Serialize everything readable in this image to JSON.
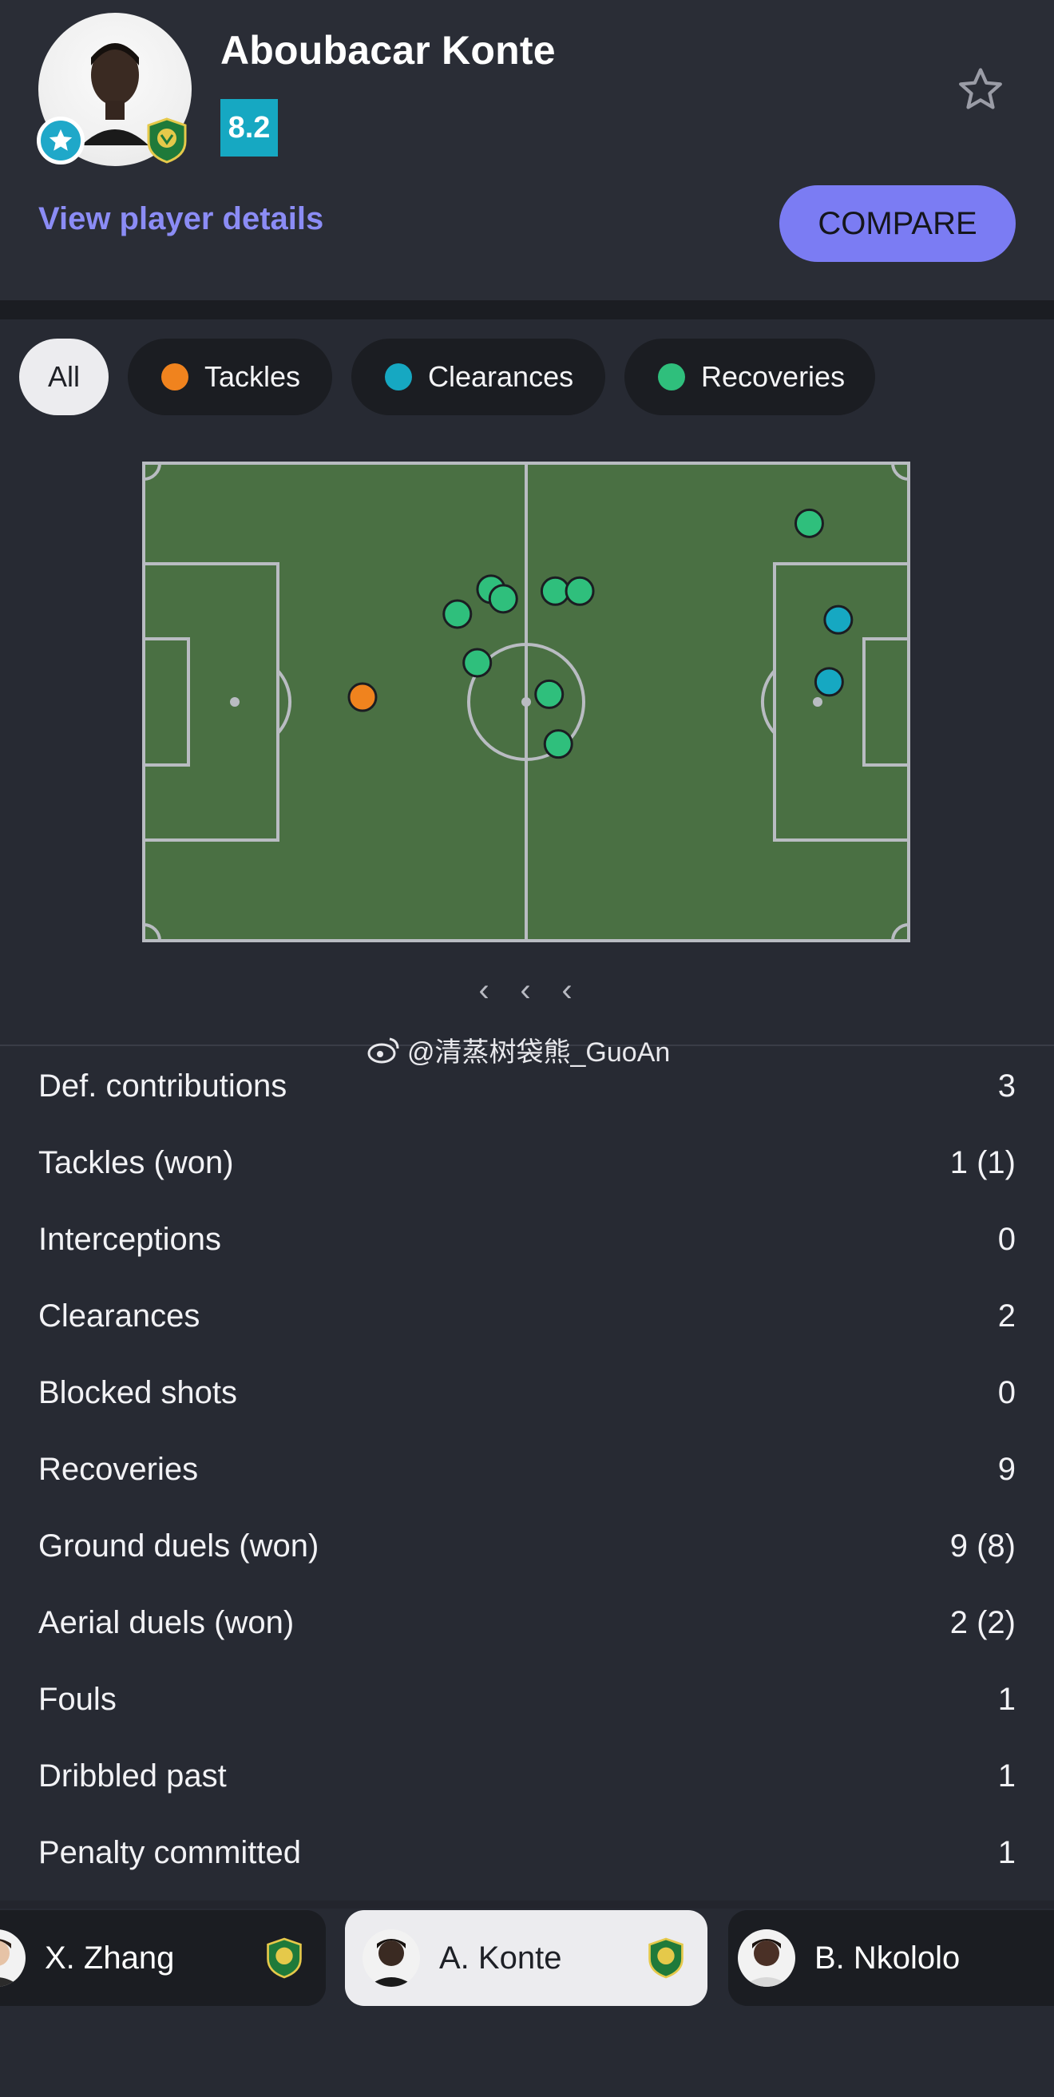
{
  "player": {
    "name": "Aboubacar Konte",
    "rating": "8.2",
    "view_details_label": "View player details",
    "compare_label": "COMPARE"
  },
  "filters": [
    {
      "label": "All",
      "active": true
    },
    {
      "label": "Tackles",
      "color": "#f0831e"
    },
    {
      "label": "Clearances",
      "color": "#16a8c2"
    },
    {
      "label": "Recoveries",
      "color": "#2fbf7c"
    }
  ],
  "colors": {
    "accent": "#7b7cf3",
    "rating_bg": "#16a8c2",
    "pitch": "#4a7043",
    "tackle": "#f0831e",
    "clearance": "#16a8c2",
    "recovery": "#2fbf7c"
  },
  "watermark": "@清蒸树袋熊_GuoAn",
  "stats": [
    {
      "label": "Def. contributions",
      "value": "3"
    },
    {
      "label": "Tackles (won)",
      "value": "1 (1)"
    },
    {
      "label": "Interceptions",
      "value": "0"
    },
    {
      "label": "Clearances",
      "value": "2"
    },
    {
      "label": "Blocked shots",
      "value": "0"
    },
    {
      "label": "Recoveries",
      "value": "9"
    },
    {
      "label": "Ground duels (won)",
      "value": "9 (8)"
    },
    {
      "label": "Aerial duels (won)",
      "value": "2 (2)"
    },
    {
      "label": "Fouls",
      "value": "1"
    },
    {
      "label": "Dribbled past",
      "value": "1"
    },
    {
      "label": "Penalty committed",
      "value": "1"
    }
  ],
  "player_cards": [
    {
      "name": "X. Zhang"
    },
    {
      "name": "A. Konte",
      "active": true
    },
    {
      "name": "B. Nkololo"
    }
  ],
  "pitch_events": [
    {
      "type": "tackle",
      "x": 28.6,
      "y": 49.0
    },
    {
      "type": "recovery",
      "x": 41.0,
      "y": 31.6
    },
    {
      "type": "recovery",
      "x": 45.4,
      "y": 26.4
    },
    {
      "type": "recovery",
      "x": 47.0,
      "y": 28.4
    },
    {
      "type": "recovery",
      "x": 43.6,
      "y": 41.8
    },
    {
      "type": "recovery",
      "x": 53.8,
      "y": 26.8
    },
    {
      "type": "recovery",
      "x": 57.0,
      "y": 26.8
    },
    {
      "type": "recovery",
      "x": 53.0,
      "y": 48.4
    },
    {
      "type": "recovery",
      "x": 54.2,
      "y": 58.8
    },
    {
      "type": "recovery",
      "x": 87.0,
      "y": 12.6
    },
    {
      "type": "clearance",
      "x": 90.8,
      "y": 32.8
    },
    {
      "type": "clearance",
      "x": 89.6,
      "y": 45.8
    }
  ]
}
